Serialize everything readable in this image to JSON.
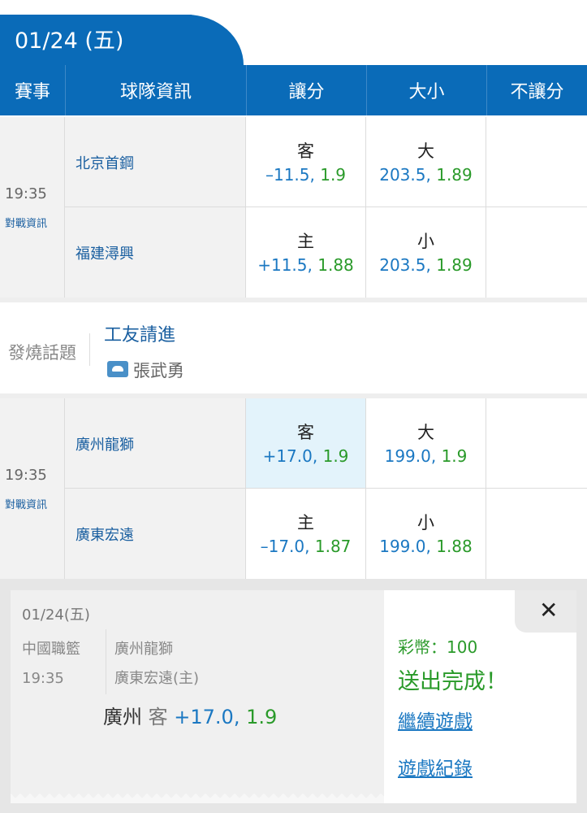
{
  "date_tab": "01/24 (五)",
  "header": {
    "event": "賽事",
    "team_info": "球隊資訊",
    "handicap": "讓分",
    "over_under": "大小",
    "moneyline": "不讓分"
  },
  "matches": [
    {
      "time": "19:35",
      "h2h_label": "對戰資訊",
      "away_team": "北京首鋼",
      "home_team": "福建潯興",
      "handicap_away_label": "客",
      "handicap_away_line": "–11.5,",
      "handicap_away_odds": "1.9",
      "handicap_home_label": "主",
      "handicap_home_line": "+11.5,",
      "handicap_home_odds": "1.88",
      "over_label": "大",
      "over_line": "203.5,",
      "over_odds": "1.89",
      "under_label": "小",
      "under_line": "203.5,",
      "under_odds": "1.89"
    },
    {
      "time": "19:35",
      "h2h_label": "對戰資訊",
      "away_team": "廣州龍獅",
      "home_team": "廣東宏遠",
      "handicap_away_label": "客",
      "handicap_away_line": "+17.0,",
      "handicap_away_odds": "1.9",
      "handicap_home_label": "主",
      "handicap_home_line": "–17.0,",
      "handicap_home_odds": "1.87",
      "over_label": "大",
      "over_line": "199.0,",
      "over_odds": "1.9",
      "under_label": "小",
      "under_line": "199.0,",
      "under_odds": "1.88"
    }
  ],
  "topic": {
    "label": "發燒話題",
    "title": "工友請進",
    "author": "張武勇"
  },
  "bet_popup": {
    "date": "01/24(五)",
    "league": "中國職籃",
    "time": "19:35",
    "team1": "廣州龍獅",
    "team2": "廣東宏遠(主)",
    "bet_team": "廣州",
    "bet_side": "客",
    "bet_line": "+17.0,",
    "bet_odds": "1.9",
    "coins": "彩幣：100",
    "done": "送出完成！",
    "continue_link": "繼續遊戲",
    "history_link": "遊戲紀錄",
    "close": "✕"
  }
}
